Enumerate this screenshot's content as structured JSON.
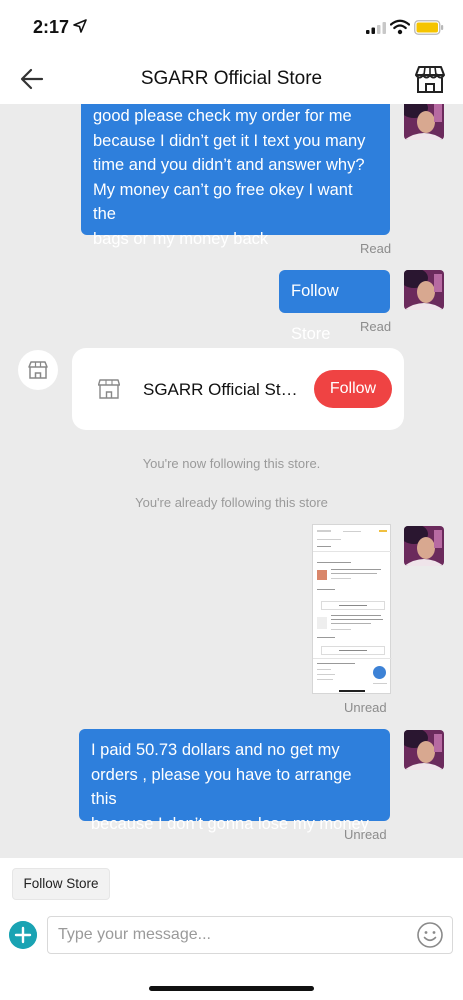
{
  "status_bar": {
    "time": "2:17"
  },
  "header": {
    "title": "SGARR Official Store"
  },
  "messages": [
    {
      "type": "text",
      "lines": [
        "good please check my order for me",
        "because I didn’t get it I text you many",
        "time and you didn’t and answer why?",
        "My money can’t go free okey I want the",
        "bags or my money back"
      ],
      "status": "Read"
    },
    {
      "type": "text",
      "lines": [
        "Follow Store"
      ],
      "status": "Read"
    },
    {
      "type": "store_card",
      "store_name": "SGARR Official Store",
      "button_label": "Follow"
    },
    {
      "type": "system",
      "text": "You're now following this store."
    },
    {
      "type": "system",
      "text": "You're already following this store"
    },
    {
      "type": "image",
      "status": "Unread"
    },
    {
      "type": "text",
      "lines": [
        "I paid 50.73 dollars and no get my",
        "orders , please you have to arrange this",
        "because I don’t gonna lose my money"
      ],
      "status": "Unread"
    }
  ],
  "quick_reply": {
    "label": "Follow Store"
  },
  "composer": {
    "placeholder": "Type your message..."
  },
  "icons": {
    "back": "back-arrow-icon",
    "store": "store-icon",
    "plus": "plus-icon",
    "emoji": "emoji-icon"
  },
  "colors": {
    "bubble": "#2e7fdc",
    "follow": "#ef4343",
    "plus": "#1aa3b3",
    "chat_bg": "#ebebeb",
    "battery": "#f5c400"
  }
}
